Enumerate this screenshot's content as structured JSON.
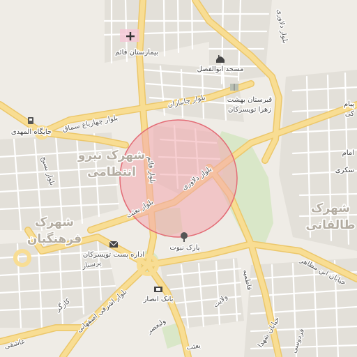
{
  "map": {
    "highlight": {
      "fill_color": "#f2a8ad",
      "stroke_color": "#e36b75",
      "opacity": 0.55
    },
    "colors": {
      "background": "#efece6",
      "park": "#d9e7c8",
      "major_road": "#f8dd93",
      "major_road_casing": "#ecc76a",
      "minor_road": "#ffffff",
      "block": "#e3e0d9"
    },
    "districts": [
      {
        "id": "niru-entezami",
        "line1": "شهرک نیرو",
        "line2": "انتظامی"
      },
      {
        "id": "farhangian",
        "line1": "شهرک",
        "line2": "فرهنگیان"
      },
      {
        "id": "taleghani",
        "line1": "شهرک",
        "line2": "طالقانی"
      }
    ],
    "pois": [
      {
        "id": "hospital",
        "label": "بیمارستان قائم",
        "icon": "hospital-cross-icon"
      },
      {
        "id": "mosque",
        "label": "مسجد ابوالفضل",
        "icon": "mosque-icon"
      },
      {
        "id": "cemetery",
        "label_line1": "قبرستان بهشت",
        "label_line2": "زهرا تویسرکان"
      },
      {
        "id": "gas",
        "label": "جایگاه المهدی",
        "icon": "gas-station-icon"
      },
      {
        "id": "park",
        "label": "پارک نبوت",
        "icon": "park-tree-icon"
      },
      {
        "id": "post",
        "label": "اداره پست تویسرکان",
        "icon": "post-envelope-icon"
      },
      {
        "id": "bank",
        "label": "بانک انصار",
        "icon": "bank-icon"
      },
      {
        "id": "right-1",
        "label": "پیام"
      },
      {
        "id": "right-2",
        "label": "کی"
      },
      {
        "id": "right-3",
        "label": "امام"
      },
      {
        "id": "right-4",
        "label": "سکری"
      }
    ],
    "streets": [
      {
        "id": "delavari-top",
        "label": "بلوار دلاوری"
      },
      {
        "id": "janbazan",
        "label": "بلوار جانبازان"
      },
      {
        "id": "chaharbagh",
        "label": "بلوار چهارباغ سماق"
      },
      {
        "id": "qaem",
        "label": "بلوار قائم"
      },
      {
        "id": "delavari-center",
        "label": "بلوار دلاوری"
      },
      {
        "id": "basij",
        "label": "بلوار بسیج"
      },
      {
        "id": "besat",
        "label": "بلوار بعثت"
      },
      {
        "id": "parastar",
        "label": "پرستار"
      },
      {
        "id": "ashrafi",
        "label": "بلوار اشرفی اصفهانی"
      },
      {
        "id": "kargar",
        "label": "کارگر"
      },
      {
        "id": "valiasr",
        "label": "ولیعصر"
      },
      {
        "id": "velayat",
        "label": "ولایت"
      },
      {
        "id": "fatemieh",
        "label": "فاطمیه"
      },
      {
        "id": "ibn-mozaher",
        "label": "خیابان ابن مظاهر"
      },
      {
        "id": "shohada",
        "label": "خیابان شهدا"
      },
      {
        "id": "ferdowsi",
        "label": "فردوسی"
      },
      {
        "id": "besat-bottom",
        "label": "بعثت"
      },
      {
        "id": "asheghi",
        "label": "عاشقی"
      }
    ]
  }
}
